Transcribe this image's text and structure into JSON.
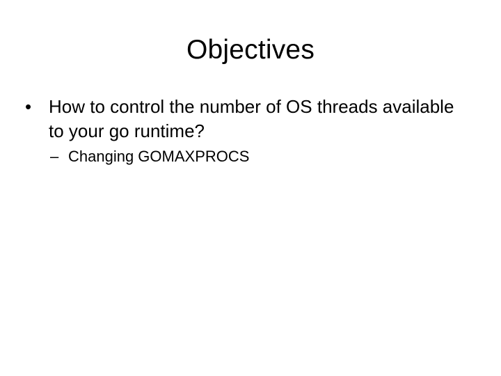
{
  "slide": {
    "title": "Objectives",
    "bullets": [
      {
        "marker": "•",
        "text": "How to control the number of OS threads available to your go runtime?",
        "sub_bullets": [
          {
            "marker": "–",
            "text": "Changing GOMAXPROCS"
          }
        ]
      }
    ]
  }
}
